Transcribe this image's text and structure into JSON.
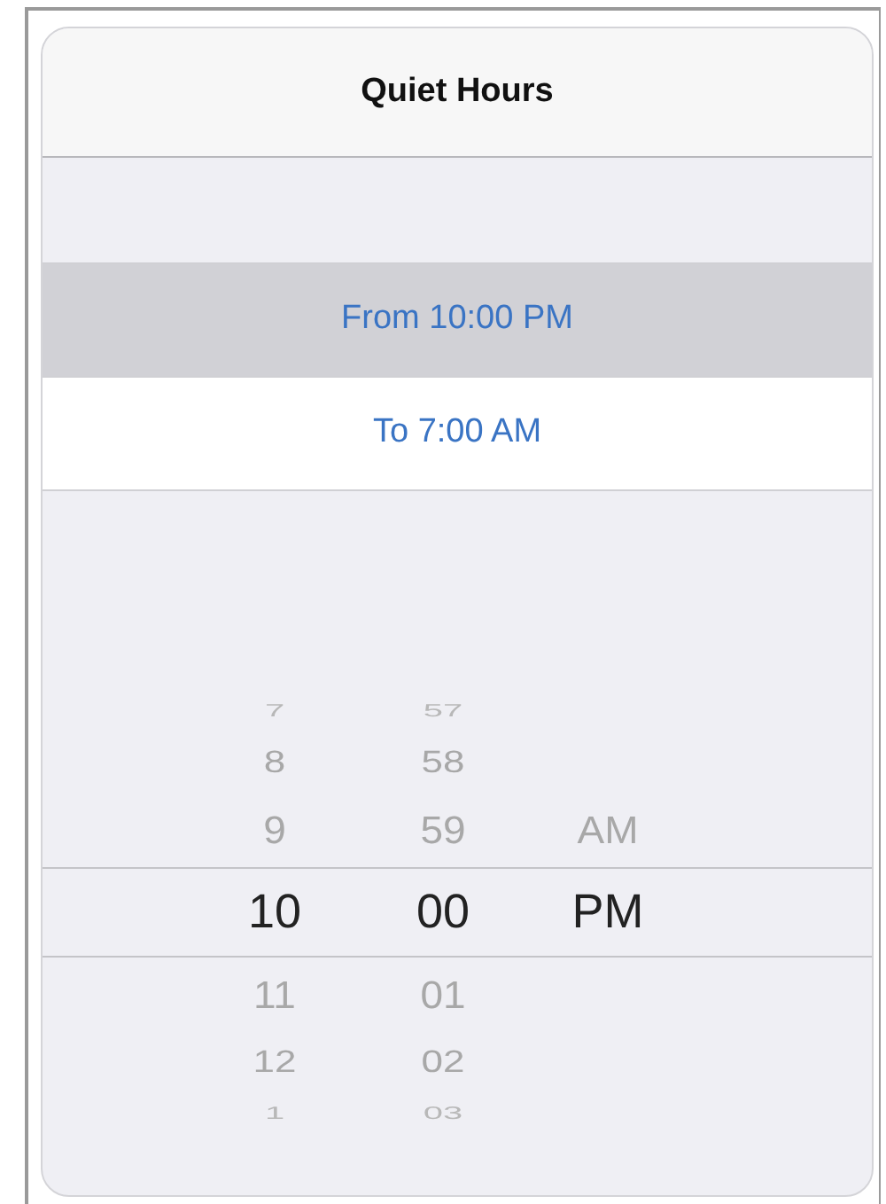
{
  "title": "Quiet Hours",
  "options": [
    {
      "label": "From 10:00 PM",
      "selected": true
    },
    {
      "label": "To 7:00 AM",
      "selected": false
    }
  ],
  "picker": {
    "rows": [
      {
        "hour": "7",
        "minute": "57",
        "selected": false
      },
      {
        "hour": "8",
        "minute": "58",
        "selected": false
      },
      {
        "hour": "9",
        "minute": "59",
        "period": "AM",
        "selected": false
      },
      {
        "hour": "10",
        "minute": "00",
        "period": "PM",
        "selected": true
      },
      {
        "hour": "11",
        "minute": "01",
        "selected": false
      },
      {
        "hour": "12",
        "minute": "02",
        "selected": false
      },
      {
        "hour": "1",
        "minute": "03",
        "selected": false
      }
    ]
  }
}
